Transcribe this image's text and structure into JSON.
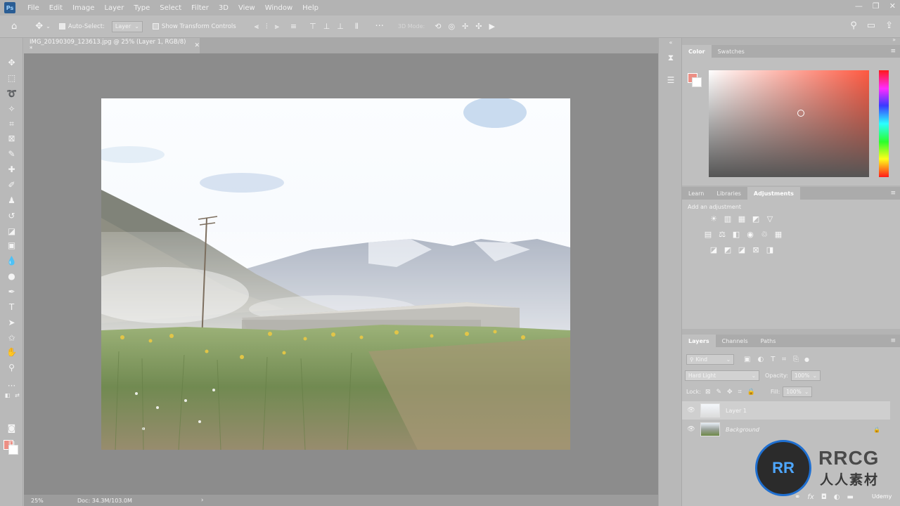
{
  "menubar": {
    "logo": "Ps",
    "items": [
      "File",
      "Edit",
      "Image",
      "Layer",
      "Type",
      "Select",
      "Filter",
      "3D",
      "View",
      "Window",
      "Help"
    ],
    "window_controls": [
      "—",
      "❐",
      "✕"
    ]
  },
  "options": {
    "auto_select_label": "Auto-Select:",
    "auto_select_checked": true,
    "auto_select_target": "Layer",
    "transform_label": "Show Transform Controls",
    "transform_checked": false,
    "mode_3d_label": "3D Mode:"
  },
  "document": {
    "tab_title": "IMG_20190309_123613.jpg @ 25% (Layer 1, RGB/8) *",
    "tab_close": "✕",
    "zoom": "25%",
    "doc_size": "Doc: 34.3M/103.0M",
    "status_arrow": "›"
  },
  "color_panel": {
    "tabs": [
      "Color",
      "Swatches"
    ],
    "active_tab": "Color",
    "foreground": "#ec8f85",
    "background": "#ffffff"
  },
  "adjustments_panel": {
    "tabs": [
      "Learn",
      "Libraries",
      "Adjustments"
    ],
    "active_tab": "Adjustments",
    "title": "Add an adjustment",
    "rows": [
      [
        "sun-icon",
        "levels-icon",
        "curves-icon",
        "exposure-icon",
        "triangle-icon"
      ],
      [
        "vibrance-icon",
        "balance-icon",
        "bw-icon",
        "camera-icon",
        "mixer-icon",
        "grid-icon"
      ],
      [
        "invert-icon",
        "posterize-icon",
        "threshold-icon",
        "selective-icon",
        "gradient-map-icon"
      ]
    ]
  },
  "layers_panel": {
    "tabs": [
      "Layers",
      "Channels",
      "Paths"
    ],
    "active_tab": "Layers",
    "filter_kind": "Kind",
    "blend_mode": "Hard Light",
    "opacity_label": "Opacity:",
    "opacity_value": "100%",
    "lock_label": "Lock:",
    "fill_label": "Fill:",
    "fill_value": "100%",
    "layers": [
      {
        "name": "Layer 1",
        "selected": true,
        "italic": false
      },
      {
        "name": "Background",
        "selected": false,
        "italic": true
      }
    ]
  },
  "watermark": {
    "logo_text": "RR",
    "brand": "RRCG",
    "brand_sub": "人人素材",
    "udemy": "Udemy"
  }
}
